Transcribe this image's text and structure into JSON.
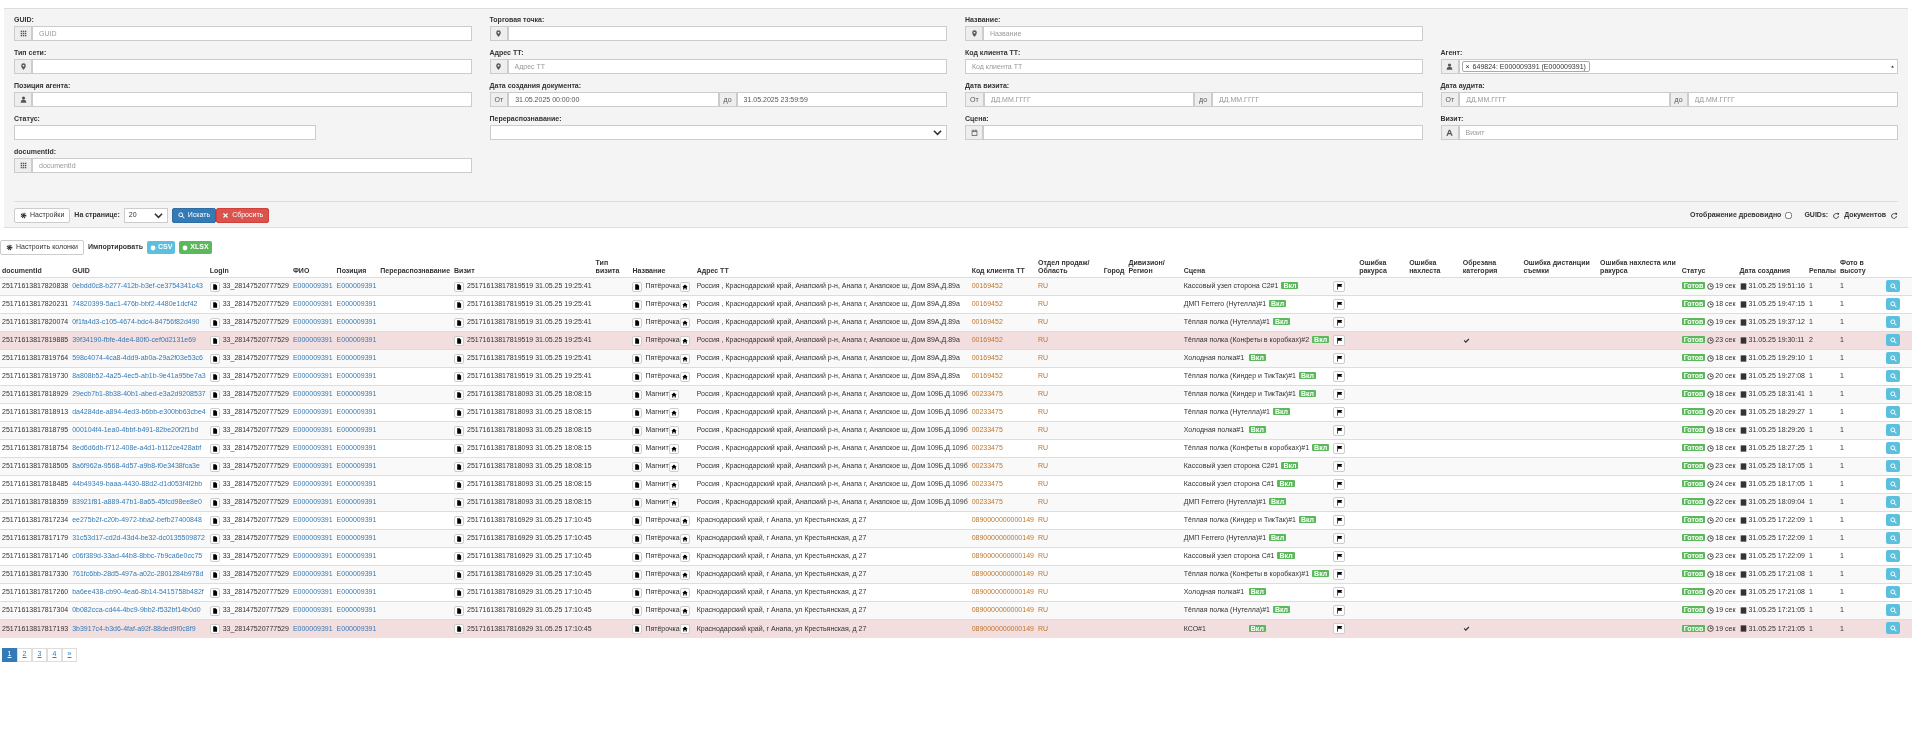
{
  "filter_rows": [
    [
      {
        "kind": "text",
        "label": "GUID:",
        "placeholder": "GUID"
      },
      {
        "kind": "text",
        "label": "Торговая точка:"
      },
      {
        "kind": "text",
        "label": "Название:",
        "placeholder": "Название"
      }
    ],
    [
      {
        "kind": "text",
        "label": "Тип сети:"
      },
      {
        "kind": "text",
        "label": "Адрес ТТ:",
        "placeholder": "Адрес ТТ"
      },
      {
        "kind": "text",
        "label": "Код клиента ТТ:",
        "placeholder": "Код клиента ТТ"
      },
      {
        "kind": "agent",
        "label": "Агент:",
        "tag_remove": "×",
        "tags": [
          "649824: E000009391 (E000009391)"
        ]
      }
    ],
    [
      {
        "kind": "text",
        "label": "Позиция агента:"
      },
      {
        "kind": "range",
        "label": "Дата создания документа:",
        "from_label": "От",
        "from_value": "31.05.2025 00:00:00",
        "to_label": "до",
        "to_value": "31.05.2025 23:59:59"
      },
      {
        "kind": "range",
        "label": "Дата визита:",
        "from_label": "От",
        "from_placeholder": "ДД.ММ.ГГГГ",
        "to_label": "до",
        "to_placeholder": "ДД.ММ.ГГГГ"
      },
      {
        "kind": "range",
        "label": "Дата аудита:",
        "from_label": "От",
        "from_placeholder": "ДД.ММ.ГГГГ",
        "to_label": "до",
        "to_placeholder": "ДД.ММ.ГГГГ"
      }
    ],
    [
      {
        "kind": "short",
        "label": "Статус:"
      },
      {
        "kind": "select",
        "label": "Перераспознавание:"
      },
      {
        "kind": "text",
        "label": "Сцена:"
      },
      {
        "kind": "text",
        "label": "Визит:",
        "placeholder": "Визит"
      }
    ],
    [
      {
        "kind": "text",
        "label": "documentId:",
        "placeholder": "documentId"
      }
    ]
  ],
  "toolbar": {
    "settings_label": "Настройки",
    "per_page_label": "На странице:",
    "per_page": "20",
    "search_label": "Искать",
    "reset_label": "Сбросить",
    "tree_view": {
      "label": "Отображение древовидно",
      "checked": false
    },
    "guids_label": "GUIDs:",
    "documents_label": "Документов"
  },
  "table_toolbar": {
    "columns_button": "Настроить колонки",
    "import_label": "Импортировать",
    "formats": [
      {
        "label": "CSV",
        "color": "#5bc0de"
      },
      {
        "label": "XLSX",
        "color": "#5cb85c"
      }
    ]
  },
  "columns": [
    {
      "title": "documentId"
    },
    {
      "title": "GUID"
    },
    {
      "title": "Login"
    },
    {
      "title": "ФИО"
    },
    {
      "title": "Позиция"
    },
    {
      "title": "Перераспознавание"
    },
    {
      "title": "Визит"
    },
    {
      "title": "Тип визита"
    },
    {
      "title": "Название"
    },
    {
      "title": "Адрес ТТ"
    },
    {
      "title": "Код клиента ТТ"
    },
    {
      "title": "Отдел продаж/Область"
    },
    {
      "title": "Город"
    },
    {
      "title": "Дивизион/Регион"
    },
    {
      "title": "Сцена"
    },
    {
      "kind": "flag"
    },
    {
      "title": "Ошибка ракурса"
    },
    {
      "title": "Ошибка нахлеста"
    },
    {
      "title": "Обрезана категория"
    },
    {
      "title": "Ошибка дистанции съемки"
    },
    {
      "title": "Ошибка нахлеста или ракурса"
    },
    {
      "title": "Статус"
    },
    {
      "title": "Дата создания"
    },
    {
      "title": "Репалы"
    },
    {
      "title": "Фото в высоту"
    },
    {
      "kind": "view"
    }
  ],
  "rows": [
    {
      "document_id": "25171613817820838",
      "guid": "0ebdd0c8-b277-412b-b3ef-ce3754341c43",
      "login": "33_28147520777529",
      "fio": "E000009391",
      "position": "E000009391",
      "visit": "25171613817819519 31.05.25 19:25:41",
      "name": "Пятёрочка",
      "address": "Россия , Краснодарский край, Анапский р-н, Анапа г, Анапское ш, Дом 89А,Д.89а",
      "client_code": "00169452",
      "region": "RU",
      "scene": "Кассовый узел сторона С2#1",
      "scene_badge": "Вкл",
      "cropped": false,
      "status": "Готов",
      "duration": "19 сек",
      "created": "31.05.25 19:51:16",
      "attempts": "1",
      "photo": "1",
      "highlighted": false
    },
    {
      "document_id": "25171613817820231",
      "guid": "74820399-5ac1-476b-bbf2-4480e1dcf42",
      "login": "33_28147520777529",
      "fio": "E000009391",
      "position": "E000009391",
      "visit": "25171613817819519 31.05.25 19:25:41",
      "name": "Пятёрочка",
      "address": "Россия , Краснодарский край, Анапский р-н, Анапа г, Анапское ш, Дом 89А,Д.89а",
      "client_code": "00169452",
      "region": "RU",
      "scene": "ДМП Ferrero (Нутелла)#1",
      "scene_badge": "Вкл",
      "cropped": false,
      "status": "Готов",
      "duration": "18 сек",
      "created": "31.05.25 19:47:15",
      "attempts": "1",
      "photo": "1",
      "highlighted": false
    },
    {
      "document_id": "25171613817820074",
      "guid": "0f1fa4d3-c105-4674-bdc4-84756f82d490",
      "login": "33_28147520777529",
      "fio": "E000009391",
      "position": "E000009391",
      "visit": "25171613817819519 31.05.25 19:25:41",
      "name": "Пятёрочка",
      "address": "Россия , Краснодарский край, Анапский р-н, Анапа г, Анапское ш, Дом 89А,Д.89а",
      "client_code": "00169452",
      "region": "RU",
      "scene": "Тёплая полка (Нутелла)#1",
      "scene_badge": "Вкл",
      "cropped": false,
      "status": "Готов",
      "duration": "19 сек",
      "created": "31.05.25 19:37:12",
      "attempts": "1",
      "photo": "1",
      "highlighted": false
    },
    {
      "document_id": "25171613817819885",
      "guid": "39f34190-fbfe-4de4-80f0-cef0d2131e69",
      "login": "33_28147520777529",
      "fio": "E000009391",
      "position": "E000009391",
      "visit": "25171613817819519 31.05.25 19:25:41",
      "name": "Пятёрочка",
      "address": "Россия , Краснодарский край, Анапский р-н, Анапа г, Анапское ш, Дом 89А,Д.89а",
      "client_code": "00169452",
      "region": "RU",
      "scene": "Тёплая полка (Конфеты в коробках)#2",
      "scene_badge": "Вкл",
      "cropped": true,
      "status": "Готов",
      "duration": "23 сек",
      "created": "31.05.25 19:30:11",
      "attempts": "2",
      "photo": "1",
      "highlighted": true
    },
    {
      "document_id": "25171613817819764",
      "guid": "598c4074-4ca8-4dd9-ab0a-29a2f03e53c6",
      "login": "33_28147520777529",
      "fio": "E000009391",
      "position": "E000009391",
      "visit": "25171613817819519 31.05.25 19:25:41",
      "name": "Пятёрочка",
      "address": "Россия , Краснодарский край, Анапский р-н, Анапа г, Анапское ш, Дом 89А,Д.89а",
      "client_code": "00169452",
      "region": "RU",
      "scene": "Холодная полка#1",
      "scene_badge": "Вкл",
      "cropped": false,
      "status": "Готов",
      "duration": "18 сек",
      "created": "31.05.25 19:29:10",
      "attempts": "1",
      "photo": "1",
      "highlighted": false
    },
    {
      "document_id": "25171613817819730",
      "guid": "8a808b52-4a25-4ec5-ab1b-9e41a95be7a3",
      "login": "33_28147520777529",
      "fio": "E000009391",
      "position": "E000009391",
      "visit": "25171613817819519 31.05.25 19:25:41",
      "name": "Пятёрочка",
      "address": "Россия , Краснодарский край, Анапский р-н, Анапа г, Анапское ш, Дом 89А,Д.89а",
      "client_code": "00169452",
      "region": "RU",
      "scene": "Тёплая полка (Киндер и ТикТак)#1",
      "scene_badge": "Вкл",
      "cropped": false,
      "status": "Готов",
      "duration": "20 сек",
      "created": "31.05.25 19:27:08",
      "attempts": "1",
      "photo": "1",
      "highlighted": false
    },
    {
      "document_id": "25171613817818929",
      "guid": "29ecb7b1-8b38-40b1-abed-e3a2d9208537",
      "login": "33_28147520777529",
      "fio": "E000009391",
      "position": "E000009391",
      "visit": "25171613817818093 31.05.25 18:08:15",
      "name": "Магнит",
      "address": "Россия , Краснодарский край, Анапский р-н, Анапа г, Анапское ш, Дом 109Б,Д.109б",
      "client_code": "00233475",
      "region": "RU",
      "scene": "Тёплая полка (Киндер и ТикТак)#1",
      "scene_badge": "Вкл",
      "cropped": false,
      "status": "Готов",
      "duration": "18 сек",
      "created": "31.05.25 18:31:41",
      "attempts": "1",
      "photo": "1",
      "highlighted": false
    },
    {
      "document_id": "25171613817818913",
      "guid": "da4284de-a894-4ed3-b6bb-e300bb63cbe4",
      "login": "33_28147520777529",
      "fio": "E000009391",
      "position": "E000009391",
      "visit": "25171613817818093 31.05.25 18:08:15",
      "name": "Магнит",
      "address": "Россия , Краснодарский край, Анапский р-н, Анапа г, Анапское ш, Дом 109Б,Д.109б",
      "client_code": "00233475",
      "region": "RU",
      "scene": "Тёплая полка (Нутелла)#1",
      "scene_badge": "Вкл",
      "cropped": false,
      "status": "Готов",
      "duration": "20 сек",
      "created": "31.05.25 18:29:27",
      "attempts": "1",
      "photo": "1",
      "highlighted": false
    },
    {
      "document_id": "25171613817818795",
      "guid": "000104f4-1ea0-4bbf-b491-82be20f2f1bd",
      "login": "33_28147520777529",
      "fio": "E000009391",
      "position": "E000009391",
      "visit": "25171613817818093 31.05.25 18:08:15",
      "name": "Магнит",
      "address": "Россия , Краснодарский край, Анапский р-н, Анапа г, Анапское ш, Дом 109Б,Д.109б",
      "client_code": "00233475",
      "region": "RU",
      "scene": "Холодная полка#1",
      "scene_badge": "Вкл",
      "cropped": false,
      "status": "Готов",
      "duration": "18 сек",
      "created": "31.05.25 18:29:26",
      "attempts": "1",
      "photo": "1",
      "highlighted": false
    },
    {
      "document_id": "25171613817818754",
      "guid": "8ed6d6db-f712-408e-a4d1-b112ce428abf",
      "login": "33_28147520777529",
      "fio": "E000009391",
      "position": "E000009391",
      "visit": "25171613817818093 31.05.25 18:08:15",
      "name": "Магнит",
      "address": "Россия , Краснодарский край, Анапский р-н, Анапа г, Анапское ш, Дом 109Б,Д.109б",
      "client_code": "00233475",
      "region": "RU",
      "scene": "Тёплая полка (Конфеты в коробках)#1",
      "scene_badge": "Вкл",
      "cropped": false,
      "status": "Готов",
      "duration": "18 сек",
      "created": "31.05.25 18:27:25",
      "attempts": "1",
      "photo": "1",
      "highlighted": false
    },
    {
      "document_id": "25171613817818505",
      "guid": "8a6f962a-9568-4d57-a9b8-f0e3438fca3e",
      "login": "33_28147520777529",
      "fio": "E000009391",
      "position": "E000009391",
      "visit": "25171613817818093 31.05.25 18:08:15",
      "name": "Магнит",
      "address": "Россия , Краснодарский край, Анапский р-н, Анапа г, Анапское ш, Дом 109Б,Д.109б",
      "client_code": "00233475",
      "region": "RU",
      "scene": "Кассовый узел сторона С2#1",
      "scene_badge": "Вкл",
      "cropped": false,
      "status": "Готов",
      "duration": "23 сек",
      "created": "31.05.25 18:17:05",
      "attempts": "1",
      "photo": "1",
      "highlighted": false
    },
    {
      "document_id": "25171613817818485",
      "guid": "44b49349-baaa-4430-88d2-d1d053f4f2bb",
      "login": "33_28147520777529",
      "fio": "E000009391",
      "position": "E000009391",
      "visit": "25171613817818093 31.05.25 18:08:15",
      "name": "Магнит",
      "address": "Россия , Краснодарский край, Анапский р-н, Анапа г, Анапское ш, Дом 109Б,Д.109б",
      "client_code": "00233475",
      "region": "RU",
      "scene": "Кассовый узел сторона С#1",
      "scene_badge": "Вкл",
      "cropped": false,
      "status": "Готов",
      "duration": "24 сек",
      "created": "31.05.25 18:17:05",
      "attempts": "1",
      "photo": "1",
      "highlighted": false
    },
    {
      "document_id": "25171613817818359",
      "guid": "83921f81-a889-47b1-8a65-45fcd98ee8e0",
      "login": "33_28147520777529",
      "fio": "E000009391",
      "position": "E000009391",
      "visit": "25171613817818093 31.05.25 18:08:15",
      "name": "Магнит",
      "address": "Россия , Краснодарский край, Анапский р-н, Анапа г, Анапское ш, Дом 109Б,Д.109б",
      "client_code": "00233475",
      "region": "RU",
      "scene": "ДМП Ferrero (Нутелла)#1",
      "scene_badge": "Вкл",
      "cropped": false,
      "status": "Готов",
      "duration": "22 сек",
      "created": "31.05.25 18:09:04",
      "attempts": "1",
      "photo": "1",
      "highlighted": false
    },
    {
      "document_id": "25171613817817234",
      "guid": "ee275b2f-c20b-4972-bba2-befb27400848",
      "login": "33_28147520777529",
      "fio": "E000009391",
      "position": "E000009391",
      "visit": "25171613817816929 31.05.25 17:10:45",
      "name": "Пятёрочка",
      "address": "Краснодарский край, г Анапа, ул Крестьянская, д 27",
      "client_code": "0890000000000149",
      "region": "RU",
      "scene": "Тёплая полка (Киндер и ТикТак)#1",
      "scene_badge": "Вкл",
      "cropped": false,
      "status": "Готов",
      "duration": "20 сек",
      "created": "31.05.25 17:22:09",
      "attempts": "1",
      "photo": "1",
      "highlighted": false
    },
    {
      "document_id": "25171613817817179",
      "guid": "31c53d17-cd2d-43d4-be32-dc0135509872",
      "login": "33_28147520777529",
      "fio": "E000009391",
      "position": "E000009391",
      "visit": "25171613817816929 31.05.25 17:10:45",
      "name": "Пятёрочка",
      "address": "Краснодарский край, г Анапа, ул Крестьянская, д 27",
      "client_code": "0890000000000149",
      "region": "RU",
      "scene": "ДМП Ferrero (Нутелла)#1",
      "scene_badge": "Вкл",
      "cropped": false,
      "status": "Готов",
      "duration": "18 сек",
      "created": "31.05.25 17:22:09",
      "attempts": "1",
      "photo": "1",
      "highlighted": false
    },
    {
      "document_id": "25171613817817146",
      "guid": "c06f389d-33ad-44b8-8bbc-7b9ca6e0cc75",
      "login": "33_28147520777529",
      "fio": "E000009391",
      "position": "E000009391",
      "visit": "25171613817816929 31.05.25 17:10:45",
      "name": "Пятёрочка",
      "address": "Краснодарский край, г Анапа, ул Крестьянская, д 27",
      "client_code": "0890000000000149",
      "region": "RU",
      "scene": "Кассовый узел сторона С#1",
      "scene_badge": "Вкл",
      "cropped": false,
      "status": "Готов",
      "duration": "23 сек",
      "created": "31.05.25 17:22:09",
      "attempts": "1",
      "photo": "1",
      "highlighted": false
    },
    {
      "document_id": "25171613817817330",
      "guid": "761fc6bb-28d5-497a-a02c-2801284b978d",
      "login": "33_28147520777529",
      "fio": "E000009391",
      "position": "E000009391",
      "visit": "25171613817816929 31.05.25 17:10:45",
      "name": "Пятёрочка",
      "address": "Краснодарский край, г Анапа, ул Крестьянская, д 27",
      "client_code": "0890000000000149",
      "region": "RU",
      "scene": "Тёплая полка (Конфеты в коробках)#1",
      "scene_badge": "Вкл",
      "cropped": false,
      "status": "Готов",
      "duration": "18 сек",
      "created": "31.05.25 17:21:08",
      "attempts": "1",
      "photo": "1",
      "highlighted": false
    },
    {
      "document_id": "25171613817817260",
      "guid": "ba6ee438-cb90-4ea6-8b14-5415758b482f",
      "login": "33_28147520777529",
      "fio": "E000009391",
      "position": "E000009391",
      "visit": "25171613817816929 31.05.25 17:10:45",
      "name": "Пятёрочка",
      "address": "Краснодарский край, г Анапа, ул Крестьянская, д 27",
      "client_code": "0890000000000149",
      "region": "RU",
      "scene": "Холодная полка#1",
      "scene_badge": "Вкл",
      "cropped": false,
      "status": "Готов",
      "duration": "20 сек",
      "created": "31.05.25 17:21:08",
      "attempts": "1",
      "photo": "1",
      "highlighted": false
    },
    {
      "document_id": "25171613817817304",
      "guid": "0b082cca-cd44-4bc9-9bb2-f532bf14b0d0",
      "login": "33_28147520777529",
      "fio": "E000009391",
      "position": "E000009391",
      "visit": "25171613817816929 31.05.25 17:10:45",
      "name": "Пятёрочка",
      "address": "Краснодарский край, г Анапа, ул Крестьянская, д 27",
      "client_code": "0890000000000149",
      "region": "RU",
      "scene": "Тёплая полка (Нутелла)#1",
      "scene_badge": "Вкл",
      "cropped": false,
      "status": "Готов",
      "duration": "19 сек",
      "created": "31.05.25 17:21:05",
      "attempts": "1",
      "photo": "1",
      "highlighted": false
    },
    {
      "document_id": "25171613817817193",
      "guid": "3b3917c4-b3d6-4faf-a92f-88ded9f0c8f9",
      "login": "33_28147520777529",
      "fio": "E000009391",
      "position": "E000009391",
      "visit": "25171613817816929 31.05.25 17:10:45",
      "name": "Пятёрочка",
      "address": "Краснодарский край, г Анапа, ул Крестьянская, д 27",
      "client_code": "0890000000000149",
      "region": "RU",
      "scene": "КСО#1",
      "scene_badge": "Вкл",
      "cropped": true,
      "status": "Готов",
      "duration": "19 сек",
      "created": "31.05.25 17:21:05",
      "attempts": "1",
      "photo": "1",
      "highlighted": true
    }
  ],
  "pagination": {
    "pages": [
      {
        "label": "1",
        "selected": true
      },
      {
        "label": "2",
        "selected": false
      },
      {
        "label": "3",
        "selected": false
      },
      {
        "label": "4",
        "selected": false
      }
    ],
    "next": "»"
  }
}
